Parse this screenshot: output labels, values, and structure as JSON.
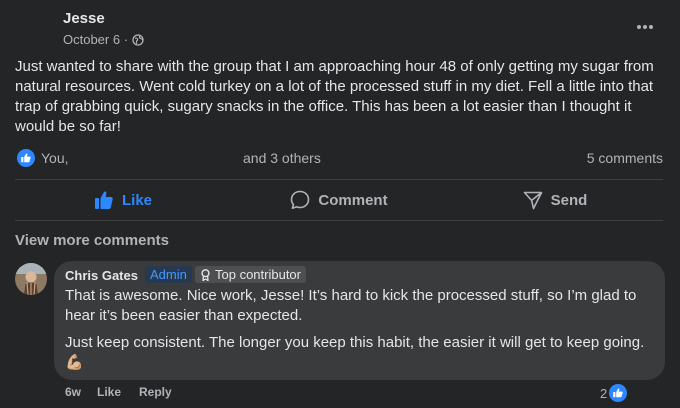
{
  "post": {
    "author": "Jesse",
    "date": "October 6 ·",
    "audience_icon": "globe-icon",
    "more_icon": "ellipsis-icon",
    "text": "Just wanted to share with the group that I am approaching hour 48 of only getting my sugar from natural resources. Went cold turkey on a lot of the processed stuff in my diet. Fell a little into that trap of grabbing quick, sugary snacks in the office. This has been a lot easier than I thought it would be so far!",
    "reactions": {
      "icon": "like-reaction-icon",
      "names": "You,",
      "others": "and 3 others",
      "comments_count": "5 comments"
    },
    "actions": {
      "like": "Like",
      "comment": "Comment",
      "send": "Send"
    },
    "view_more_comments": "View more comments"
  },
  "comment": {
    "author": "Chris Gates",
    "admin_badge": "Admin",
    "contributor_badge": "Top contributor",
    "paragraphs": [
      "That is awesome. Nice work, Jesse! It’s hard to kick the processed stuff, so I’m glad to hear it’s been easier than expected.",
      "Just keep consistent. The longer you keep this habit, the easier it will get to keep going. 💪🏼"
    ],
    "age": "6w",
    "like_label": "Like",
    "reply_label": "Reply",
    "reaction_count": "2"
  },
  "colors": {
    "background": "#242526",
    "bubble": "#3a3b3c",
    "accent": "#2d88ff",
    "text": "#e4e6eb",
    "muted": "#b0b3b8"
  }
}
